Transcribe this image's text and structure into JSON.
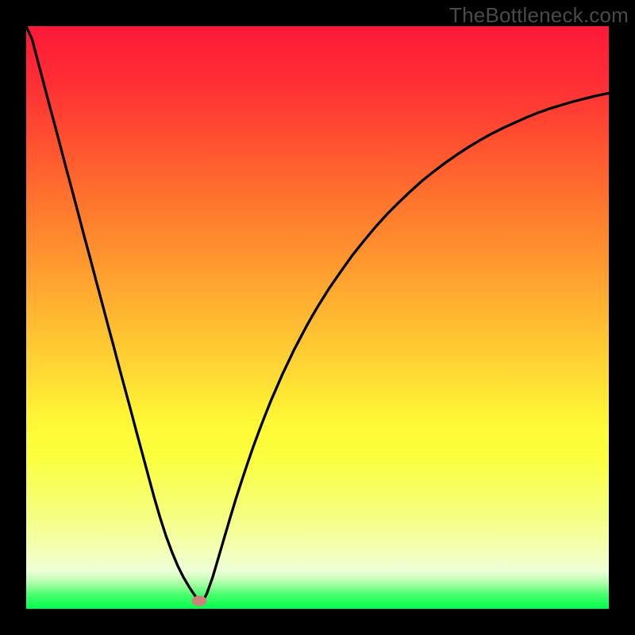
{
  "watermark": {
    "text": "TheBottleneck.com"
  },
  "chart_data": {
    "type": "line",
    "title": "",
    "xlabel": "",
    "ylabel": "",
    "xlim": [
      0,
      100
    ],
    "ylim": [
      0,
      100
    ],
    "legend": false,
    "background": "rainbow-vertical-gradient",
    "gradient_stops": [
      {
        "pct": 0,
        "color": "#ff1838"
      },
      {
        "pct": 10,
        "color": "#ff2f34"
      },
      {
        "pct": 20,
        "color": "#ff5130"
      },
      {
        "pct": 30,
        "color": "#ff742e"
      },
      {
        "pct": 40,
        "color": "#ff962f"
      },
      {
        "pct": 50,
        "color": "#ffb931"
      },
      {
        "pct": 60,
        "color": "#ffdb34"
      },
      {
        "pct": 68,
        "color": "#fff835"
      },
      {
        "pct": 74,
        "color": "#fbff3d"
      },
      {
        "pct": 84,
        "color": "#f5ff80"
      },
      {
        "pct": 90,
        "color": "#f4ffb6"
      },
      {
        "pct": 93.5,
        "color": "#eeffd6"
      },
      {
        "pct": 94.9,
        "color": "#c7ffba"
      },
      {
        "pct": 96.2,
        "color": "#8eff95"
      },
      {
        "pct": 97.5,
        "color": "#4cff6f"
      },
      {
        "pct": 100,
        "color": "#00ff4c"
      }
    ],
    "series": [
      {
        "name": "bottleneck-curve",
        "x": [
          0.0,
          1.0,
          2.0,
          3.0,
          4.0,
          5.0,
          6.0,
          7.0,
          8.0,
          9.0,
          10.0,
          11.0,
          12.0,
          13.0,
          14.0,
          15.0,
          16.0,
          17.0,
          18.0,
          19.0,
          20.0,
          21.0,
          22.0,
          23.0,
          24.0,
          25.0,
          26.0,
          27.0,
          28.0,
          29.0,
          29.7,
          30.0,
          30.5,
          31.0,
          32.0,
          33.0,
          34.0,
          35.0,
          36.0,
          37.0,
          38.0,
          39.0,
          40.0,
          41.0,
          42.0,
          43.0,
          44.0,
          45.0,
          46.0,
          47.0,
          48.0,
          49.0,
          50.0,
          52.0,
          54.0,
          56.0,
          58.0,
          60.0,
          62.0,
          64.0,
          66.0,
          68.0,
          70.0,
          72.0,
          74.0,
          76.0,
          78.0,
          80.0,
          82.0,
          84.0,
          86.0,
          88.0,
          90.0,
          92.0,
          94.0,
          96.0,
          98.0,
          100.0
        ],
        "y": [
          100.0,
          97.8,
          94.0,
          90.2,
          86.4,
          82.7,
          78.9,
          75.1,
          71.4,
          67.6,
          63.8,
          60.1,
          56.3,
          52.6,
          48.8,
          45.1,
          41.3,
          37.6,
          33.9,
          30.1,
          26.4,
          22.7,
          19.0,
          15.6,
          12.5,
          9.8,
          7.4,
          5.4,
          3.7,
          2.2,
          1.3,
          1.1,
          1.6,
          2.6,
          5.4,
          8.8,
          12.2,
          15.6,
          18.9,
          22.0,
          25.0,
          27.9,
          30.6,
          33.2,
          35.7,
          38.0,
          40.3,
          42.4,
          44.5,
          46.4,
          48.3,
          50.1,
          51.8,
          55.0,
          57.9,
          60.7,
          63.2,
          65.6,
          67.8,
          69.8,
          71.7,
          73.5,
          75.1,
          76.6,
          78.0,
          79.3,
          80.5,
          81.6,
          82.6,
          83.5,
          84.4,
          85.2,
          85.9,
          86.5,
          87.1,
          87.6,
          88.1,
          88.5
        ]
      }
    ],
    "marker": {
      "x": 29.7,
      "y": 1.3,
      "color": "#cd8179"
    }
  }
}
